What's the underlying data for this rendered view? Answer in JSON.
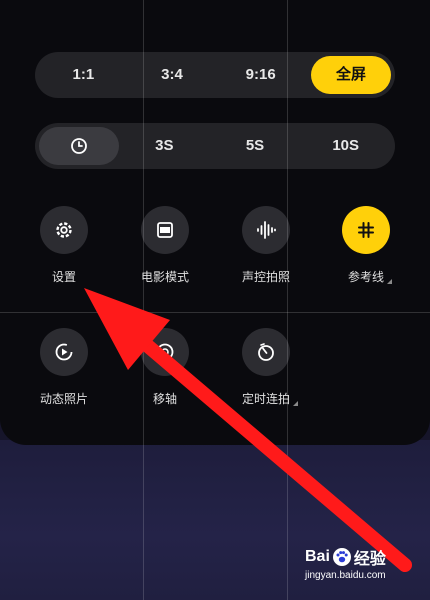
{
  "aspect_ratio": {
    "options": [
      "1:1",
      "3:4",
      "9:16",
      "全屏"
    ],
    "selected": "全屏"
  },
  "timer": {
    "options": [
      "3S",
      "5S",
      "10S"
    ],
    "selected_icon": "clock-icon"
  },
  "tiles": [
    {
      "label": "设置",
      "icon": "gear-icon"
    },
    {
      "label": "电影模式",
      "icon": "widescreen-icon"
    },
    {
      "label": "声控拍照",
      "icon": "sound-wave-icon"
    },
    {
      "label": "参考线",
      "icon": "grid-icon",
      "active": true
    },
    {
      "label": "动态照片",
      "icon": "live-photo-icon"
    },
    {
      "label": "移轴",
      "icon": "tilt-shift-icon"
    },
    {
      "label": "定时连拍",
      "icon": "timer-burst-icon"
    }
  ],
  "colors": {
    "accent": "#ffd00a",
    "arrow": "#ff1a1a",
    "panel": "#0a0a0e"
  },
  "watermark": {
    "brand_a": "Bai",
    "brand_b": "经验",
    "url": "jingyan.baidu.com"
  }
}
